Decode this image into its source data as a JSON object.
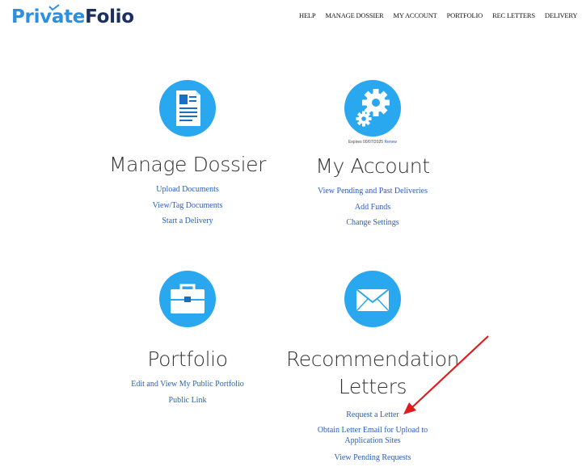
{
  "header": {
    "logo_part1": "Private",
    "logo_part2": "Folio",
    "nav": [
      "HELP",
      "MANAGE DOSSIER",
      "MY ACCOUNT",
      "PORTFOLIO",
      "REC LETTERS",
      "DELIVERY"
    ]
  },
  "tiles": {
    "dossier": {
      "title": "Manage Dossier",
      "icon": "document-icon",
      "links": [
        "Upload Documents",
        "View/Tag Documents",
        "Start a Delivery"
      ]
    },
    "account": {
      "title": "My Account",
      "icon": "gear-icon",
      "expires_text": "Expires 00/07/2025",
      "renew": "Renew",
      "links": [
        "View Pending and Past Deliveries",
        "Add Funds",
        "Change Settings"
      ]
    },
    "portfolio": {
      "title": "Portfolio",
      "icon": "briefcase-icon",
      "links": [
        "Edit and View My Public Portfolio",
        "Public Link"
      ]
    },
    "letters": {
      "title_line1": "Recommendation",
      "title_line2": "Letters",
      "icon": "envelope-icon",
      "links": [
        "Request a Letter",
        "Obtain Letter Email for Upload to Application Sites",
        "View Pending Requests"
      ]
    }
  },
  "colors": {
    "icon_blue": "#29a8f0",
    "link_blue": "#2a5fb8",
    "arrow_red": "#e11b1b",
    "logo_blue": "#2d8fe0",
    "logo_navy": "#1c2f63"
  }
}
